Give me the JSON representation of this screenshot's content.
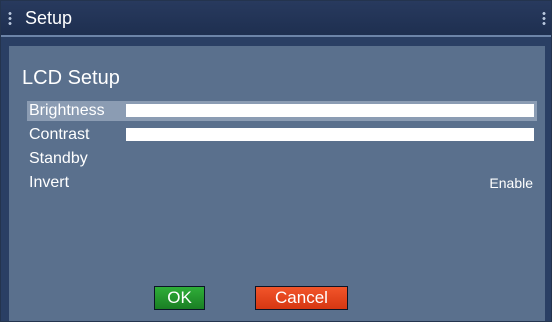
{
  "window": {
    "title": "Setup"
  },
  "main": {
    "header": "LCD Setup",
    "items": [
      {
        "label": "Brightness",
        "level": 1.0,
        "selected": true
      },
      {
        "label": "Contrast",
        "level": 1.0,
        "selected": false
      },
      {
        "label": "Standby",
        "value": "",
        "selected": false
      },
      {
        "label": "Invert",
        "value": "Enable",
        "selected": false
      }
    ]
  },
  "buttons": {
    "ok": "OK",
    "cancel": "Cancel"
  },
  "colors": {
    "title_bar": "#1e2f50",
    "panel": "#5a708d",
    "selection": "#8b9cb3",
    "ok_button": "#1f8c2a",
    "cancel_button": "#e8481c"
  }
}
